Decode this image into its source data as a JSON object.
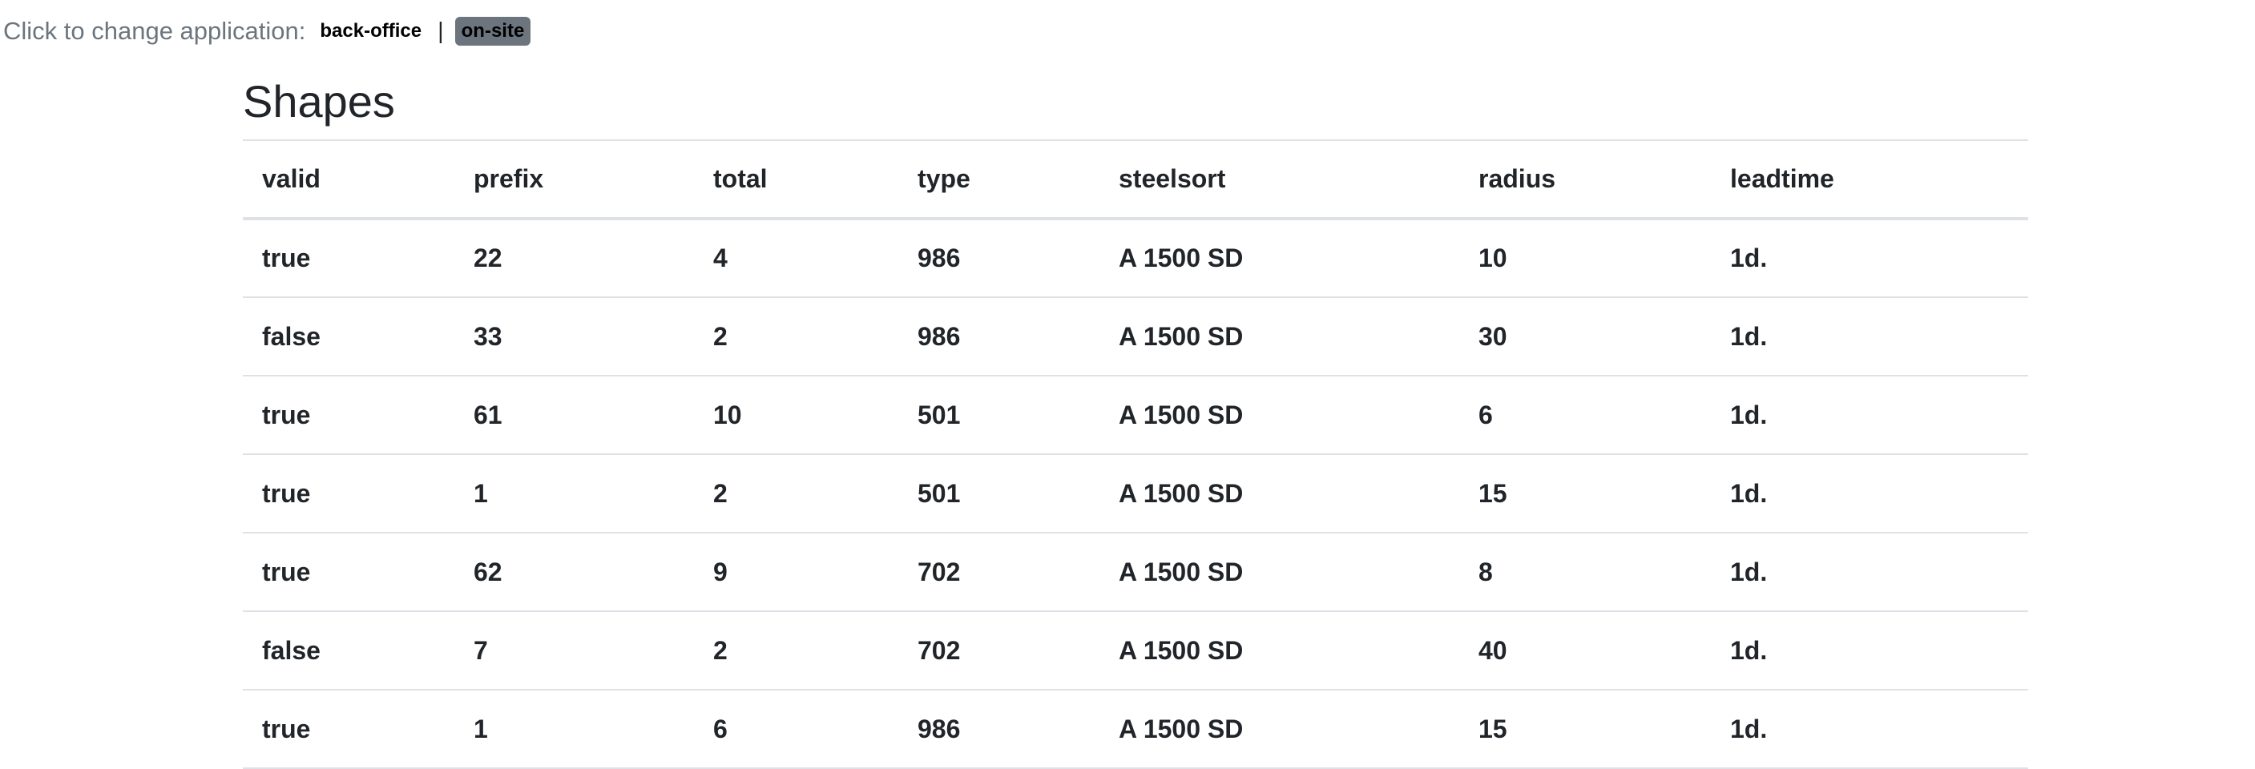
{
  "app_switcher": {
    "label": "Click to change application:",
    "links": [
      {
        "label": "back-office",
        "active": false
      },
      {
        "label": "on-site",
        "active": true
      }
    ],
    "separator": "|",
    "badge_color": "#6c757d"
  },
  "page": {
    "title": "Shapes"
  },
  "table": {
    "columns": [
      "valid",
      "prefix",
      "total",
      "type",
      "steelsort",
      "radius",
      "leadtime"
    ],
    "rows": [
      [
        "true",
        "22",
        "4",
        "986",
        "A 1500 SD",
        "10",
        "1d."
      ],
      [
        "false",
        "33",
        "2",
        "986",
        "A 1500 SD",
        "30",
        "1d."
      ],
      [
        "true",
        "61",
        "10",
        "501",
        "A 1500 SD",
        "6",
        "1d."
      ],
      [
        "true",
        "1",
        "2",
        "501",
        "A 1500 SD",
        "15",
        "1d."
      ],
      [
        "true",
        "62",
        "9",
        "702",
        "A 1500 SD",
        "8",
        "1d."
      ],
      [
        "false",
        "7",
        "2",
        "702",
        "A 1500 SD",
        "40",
        "1d."
      ],
      [
        "true",
        "1",
        "6",
        "986",
        "A 1500 SD",
        "15",
        "1d."
      ]
    ]
  }
}
